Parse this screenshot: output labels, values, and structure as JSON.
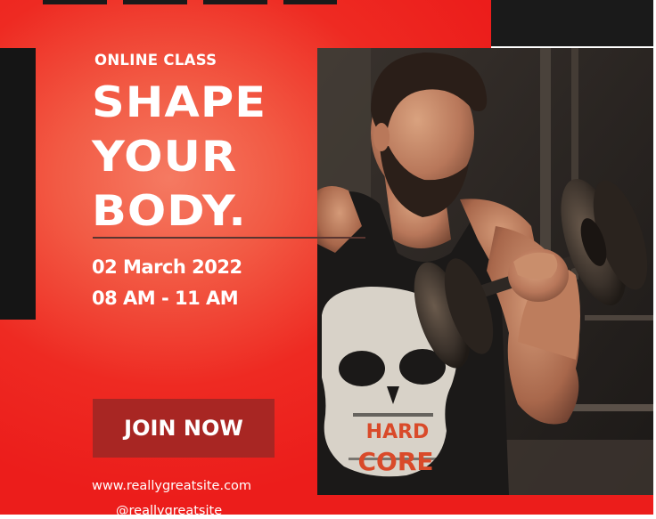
{
  "poster": {
    "kicker": "ONLINE CLASS",
    "headline": [
      "SHAPE",
      "YOUR",
      "BODY."
    ],
    "date": "02 March 2022",
    "time": "08 AM - 11 AM",
    "cta_label": "JOIN NOW",
    "website": "www.reallygreatsite.com",
    "handle": "@reallygreatsite"
  },
  "photo": {
    "shirt_text_line1": "HARD",
    "shirt_text_line2": "CORE"
  },
  "colors": {
    "background_red": "#ec1d1b",
    "background_glow": "#f57a62",
    "accent_black": "#1a1a1a",
    "button": "#a82623",
    "text": "#ffffff"
  }
}
